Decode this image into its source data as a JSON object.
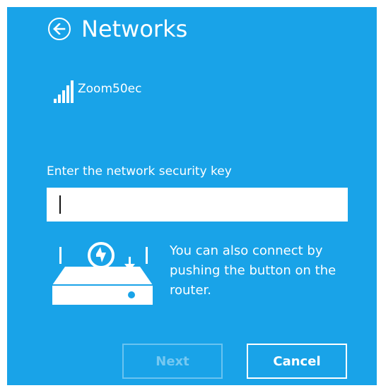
{
  "header": {
    "title": "Networks",
    "back_icon": "back-arrow-icon"
  },
  "network": {
    "name": "Zoom50ec",
    "signal_icon": "wifi-signal-icon",
    "signal_bars": 5
  },
  "form": {
    "key_label": "Enter the network security key",
    "key_value": ""
  },
  "hint": {
    "text": "You can also connect by pushing the button on the router.",
    "icon": "router-wps-icon"
  },
  "buttons": {
    "next_label": "Next",
    "cancel_label": "Cancel"
  },
  "colors": {
    "background": "#19a3e8",
    "text": "#ffffff"
  }
}
